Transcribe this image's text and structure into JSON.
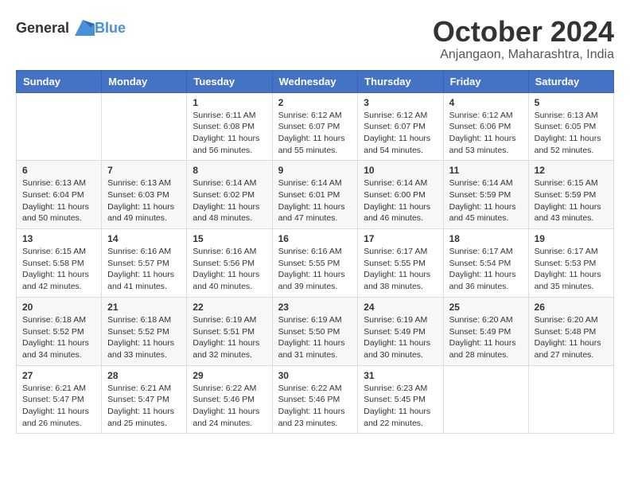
{
  "header": {
    "logo_general": "General",
    "logo_blue": "Blue",
    "month": "October 2024",
    "location": "Anjangaon, Maharashtra, India"
  },
  "days_of_week": [
    "Sunday",
    "Monday",
    "Tuesday",
    "Wednesday",
    "Thursday",
    "Friday",
    "Saturday"
  ],
  "weeks": [
    [
      {
        "day": "",
        "content": ""
      },
      {
        "day": "",
        "content": ""
      },
      {
        "day": "1",
        "content": "Sunrise: 6:11 AM\nSunset: 6:08 PM\nDaylight: 11 hours and 56 minutes."
      },
      {
        "day": "2",
        "content": "Sunrise: 6:12 AM\nSunset: 6:07 PM\nDaylight: 11 hours and 55 minutes."
      },
      {
        "day": "3",
        "content": "Sunrise: 6:12 AM\nSunset: 6:07 PM\nDaylight: 11 hours and 54 minutes."
      },
      {
        "day": "4",
        "content": "Sunrise: 6:12 AM\nSunset: 6:06 PM\nDaylight: 11 hours and 53 minutes."
      },
      {
        "day": "5",
        "content": "Sunrise: 6:13 AM\nSunset: 6:05 PM\nDaylight: 11 hours and 52 minutes."
      }
    ],
    [
      {
        "day": "6",
        "content": "Sunrise: 6:13 AM\nSunset: 6:04 PM\nDaylight: 11 hours and 50 minutes."
      },
      {
        "day": "7",
        "content": "Sunrise: 6:13 AM\nSunset: 6:03 PM\nDaylight: 11 hours and 49 minutes."
      },
      {
        "day": "8",
        "content": "Sunrise: 6:14 AM\nSunset: 6:02 PM\nDaylight: 11 hours and 48 minutes."
      },
      {
        "day": "9",
        "content": "Sunrise: 6:14 AM\nSunset: 6:01 PM\nDaylight: 11 hours and 47 minutes."
      },
      {
        "day": "10",
        "content": "Sunrise: 6:14 AM\nSunset: 6:00 PM\nDaylight: 11 hours and 46 minutes."
      },
      {
        "day": "11",
        "content": "Sunrise: 6:14 AM\nSunset: 5:59 PM\nDaylight: 11 hours and 45 minutes."
      },
      {
        "day": "12",
        "content": "Sunrise: 6:15 AM\nSunset: 5:59 PM\nDaylight: 11 hours and 43 minutes."
      }
    ],
    [
      {
        "day": "13",
        "content": "Sunrise: 6:15 AM\nSunset: 5:58 PM\nDaylight: 11 hours and 42 minutes."
      },
      {
        "day": "14",
        "content": "Sunrise: 6:16 AM\nSunset: 5:57 PM\nDaylight: 11 hours and 41 minutes."
      },
      {
        "day": "15",
        "content": "Sunrise: 6:16 AM\nSunset: 5:56 PM\nDaylight: 11 hours and 40 minutes."
      },
      {
        "day": "16",
        "content": "Sunrise: 6:16 AM\nSunset: 5:55 PM\nDaylight: 11 hours and 39 minutes."
      },
      {
        "day": "17",
        "content": "Sunrise: 6:17 AM\nSunset: 5:55 PM\nDaylight: 11 hours and 38 minutes."
      },
      {
        "day": "18",
        "content": "Sunrise: 6:17 AM\nSunset: 5:54 PM\nDaylight: 11 hours and 36 minutes."
      },
      {
        "day": "19",
        "content": "Sunrise: 6:17 AM\nSunset: 5:53 PM\nDaylight: 11 hours and 35 minutes."
      }
    ],
    [
      {
        "day": "20",
        "content": "Sunrise: 6:18 AM\nSunset: 5:52 PM\nDaylight: 11 hours and 34 minutes."
      },
      {
        "day": "21",
        "content": "Sunrise: 6:18 AM\nSunset: 5:52 PM\nDaylight: 11 hours and 33 minutes."
      },
      {
        "day": "22",
        "content": "Sunrise: 6:19 AM\nSunset: 5:51 PM\nDaylight: 11 hours and 32 minutes."
      },
      {
        "day": "23",
        "content": "Sunrise: 6:19 AM\nSunset: 5:50 PM\nDaylight: 11 hours and 31 minutes."
      },
      {
        "day": "24",
        "content": "Sunrise: 6:19 AM\nSunset: 5:49 PM\nDaylight: 11 hours and 30 minutes."
      },
      {
        "day": "25",
        "content": "Sunrise: 6:20 AM\nSunset: 5:49 PM\nDaylight: 11 hours and 28 minutes."
      },
      {
        "day": "26",
        "content": "Sunrise: 6:20 AM\nSunset: 5:48 PM\nDaylight: 11 hours and 27 minutes."
      }
    ],
    [
      {
        "day": "27",
        "content": "Sunrise: 6:21 AM\nSunset: 5:47 PM\nDaylight: 11 hours and 26 minutes."
      },
      {
        "day": "28",
        "content": "Sunrise: 6:21 AM\nSunset: 5:47 PM\nDaylight: 11 hours and 25 minutes."
      },
      {
        "day": "29",
        "content": "Sunrise: 6:22 AM\nSunset: 5:46 PM\nDaylight: 11 hours and 24 minutes."
      },
      {
        "day": "30",
        "content": "Sunrise: 6:22 AM\nSunset: 5:46 PM\nDaylight: 11 hours and 23 minutes."
      },
      {
        "day": "31",
        "content": "Sunrise: 6:23 AM\nSunset: 5:45 PM\nDaylight: 11 hours and 22 minutes."
      },
      {
        "day": "",
        "content": ""
      },
      {
        "day": "",
        "content": ""
      }
    ]
  ]
}
